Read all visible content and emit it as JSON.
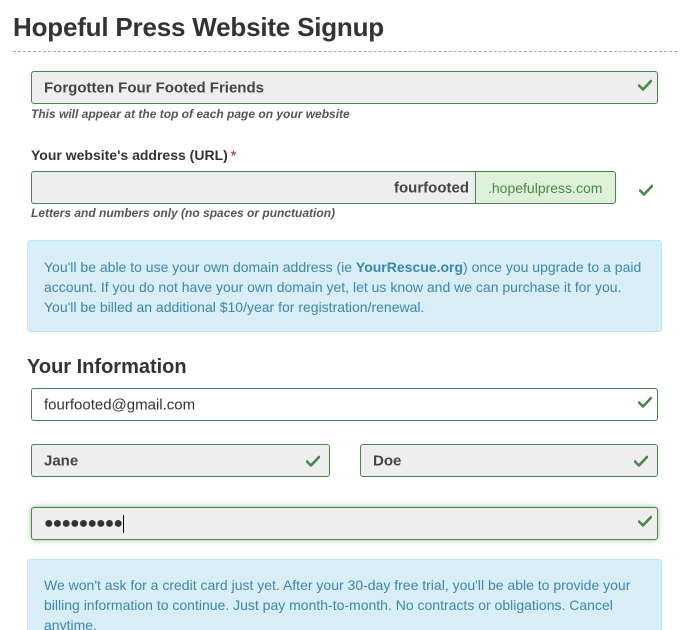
{
  "page": {
    "title": "Hopeful Press Website Signup"
  },
  "site_name": {
    "value": "Forgotten Four Footed Friends",
    "help": "This will appear at the top of each page on your website"
  },
  "url": {
    "label": "Your website's address (URL)",
    "required_mark": "*",
    "value": "fourfooted",
    "suffix": ".hopefulpress.com",
    "help": "Letters and numbers only (no spaces or punctuation)"
  },
  "domain_info": {
    "text_before": "You'll be able to use your own domain address (ie ",
    "highlight": "YourRescue.org",
    "text_after": ") once you upgrade to a paid account. If you do not have your own domain yet, let us know and we can purchase it for you. You'll be billed an additional $10/year for registration/renewal."
  },
  "your_info": {
    "heading": "Your Information",
    "email": "fourfooted@gmail.com",
    "first_name": "Jane",
    "last_name": "Doe",
    "password_mask": "●●●●●●●●●"
  },
  "trial_info": {
    "text": "We won't ask for a credit card just yet. After your 30-day free trial, you'll be able to provide your billing information to continue. Just pay month-to-month. No contracts or obligations. Cancel anytime."
  },
  "icons": {
    "valid": "check-icon"
  },
  "colors": {
    "valid_green": "#468847",
    "info_bg": "#d9edf7",
    "info_text": "#3a87ad",
    "required_red": "#b94a48"
  }
}
